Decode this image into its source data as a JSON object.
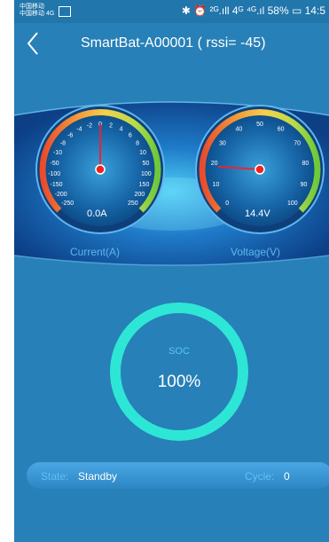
{
  "status_bar": {
    "carrier_line1": "中国移动",
    "carrier_line2": "中国移动 4G",
    "right_text": "✱ ⏰ ²ᴳ.ıll 4ᴳ ⁴ᴳ.ıl 58% ▭ 14:5"
  },
  "nav": {
    "back_icon": "chevron-left",
    "title": "SmartBat-A00001  ( rssi= -45)"
  },
  "gauges": {
    "current": {
      "label": "Current(A)",
      "display": "0.0A",
      "value": 0,
      "ticks": [
        "-250",
        "-200",
        "-150",
        "-100",
        "-50",
        "-10",
        "-8",
        "-6",
        "-4",
        "-2",
        "0",
        "2",
        "4",
        "6",
        "8",
        "10",
        "50",
        "100",
        "150",
        "200",
        "250"
      ]
    },
    "voltage": {
      "label": "Voltage(V)",
      "display": "14.4V",
      "value": 14.4,
      "ticks": [
        "0",
        "10",
        "20",
        "30",
        "40",
        "50",
        "60",
        "70",
        "80",
        "90",
        "100"
      ]
    }
  },
  "soc": {
    "label": "SOC",
    "value": "100%",
    "fraction": 1.0,
    "ring_color": "#2ee6d6"
  },
  "state_bar": {
    "state_label": "State:",
    "state_value": "Standby",
    "cycle_label": "Cycle:",
    "cycle_value": "0"
  }
}
